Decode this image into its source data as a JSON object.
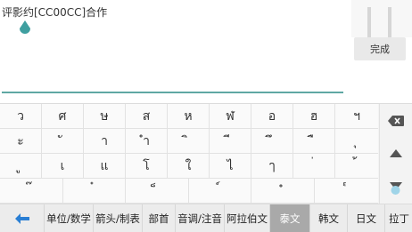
{
  "editor": {
    "text": "评影约[CC00CC]合作",
    "done_label": "完成"
  },
  "keyboard": {
    "rows": [
      [
        "ว",
        "ศ",
        "ษ",
        "ส",
        "ห",
        "ฬ",
        "อ",
        "ฮ",
        "ฯ"
      ],
      [
        "ะ",
        "ั",
        "า",
        "ำ",
        "ิ",
        "ี",
        "ึ",
        "ื",
        "ุ"
      ],
      [
        "ู",
        "เ",
        "แ",
        "โ",
        "ใ",
        "ไ",
        "ๅ",
        "่",
        "้"
      ],
      [
        "๊",
        "๋",
        "็",
        "์",
        "ํ",
        "๎",
        "๏",
        "๐",
        "๛"
      ]
    ],
    "side_keys": [
      "backspace-icon",
      "up-arrow-icon",
      "down-arrow-icon"
    ]
  },
  "tabs": {
    "back_icon": "back-arrow-icon",
    "items": [
      {
        "label": "单位/数学"
      },
      {
        "label": "箭头/制表"
      },
      {
        "label": "部首"
      },
      {
        "label": "音调/注音"
      },
      {
        "label": "阿拉伯文"
      },
      {
        "label": "泰文"
      },
      {
        "label": "韩文"
      },
      {
        "label": "日文"
      },
      {
        "label": "拉丁"
      }
    ],
    "active_index": 5
  },
  "colors": {
    "accent": "#5fa8a3",
    "back_icon": "#2a7fd4",
    "active_tab": "#a9a9a9"
  }
}
